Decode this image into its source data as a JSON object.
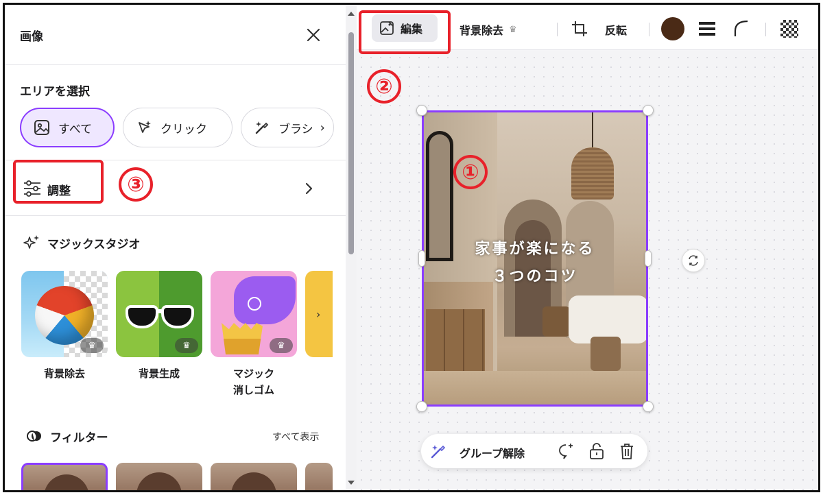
{
  "panel": {
    "title": "画像",
    "area_section_label": "エリアを選択",
    "area_chips": [
      {
        "label": "すべて",
        "icon": "image-icon",
        "selected": true
      },
      {
        "label": "クリック",
        "icon": "sparkle-cursor-icon",
        "selected": false
      },
      {
        "label": "ブラシ",
        "icon": "magic-brush-icon",
        "selected": false
      }
    ],
    "adjust_label": "調整",
    "magic_studio_label": "マジックスタジオ",
    "magic_tools": [
      {
        "label": "背景除去",
        "pro": true
      },
      {
        "label": "背景生成",
        "pro": true
      },
      {
        "label_line1": "マジック",
        "label_line2": "消しゴム",
        "pro": true
      }
    ],
    "filter_label": "フィルター",
    "show_all_label": "すべて表示"
  },
  "toolbar": {
    "edit_label": "編集",
    "bg_remove_label": "背景除去",
    "flip_label": "反転",
    "color_swatch": "#4a2a16"
  },
  "canvas": {
    "caption_line1": "家事が楽になる",
    "caption_line2": "３つのコツ"
  },
  "floating_bar": {
    "ungroup_label": "グループ解除"
  },
  "annotations": {
    "marker_1": "①",
    "marker_2": "②",
    "marker_3": "③",
    "color": "#e8212a"
  },
  "colors": {
    "selection": "#8b3dff",
    "chip_selected_bg": "#efe7ff"
  }
}
